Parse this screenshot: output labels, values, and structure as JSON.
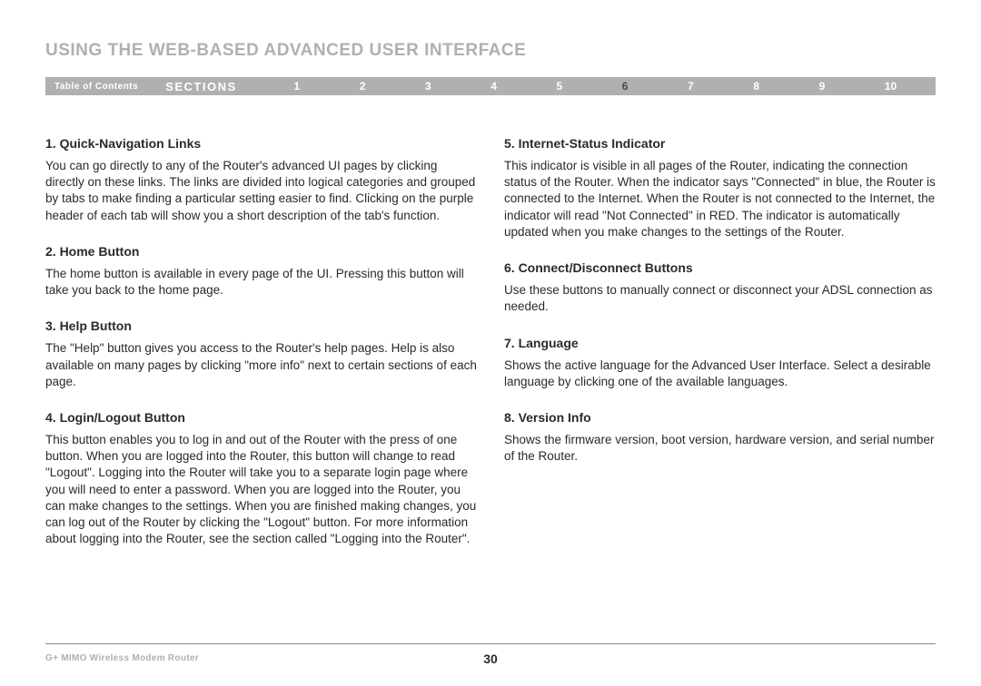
{
  "title": "USING THE WEB-BASED ADVANCED USER INTERFACE",
  "nav": {
    "toc": "Table of Contents",
    "sections_label": "SECTIONS",
    "numbers": [
      "1",
      "2",
      "3",
      "4",
      "5",
      "6",
      "7",
      "8",
      "9",
      "10"
    ],
    "active": "6"
  },
  "left": [
    {
      "heading": "1. Quick-Navigation Links",
      "body": "You can go directly to any of the Router's advanced UI pages by clicking directly on these links. The links are divided into logical categories and grouped by tabs to make finding a particular setting easier to find. Clicking on the purple header of each tab will show you a short description of the tab's function."
    },
    {
      "heading": "2. Home Button",
      "body": "The home button is available in every page of the UI. Pressing this button will take you back to the home page."
    },
    {
      "heading": "3. Help Button",
      "body": "The \"Help\" button gives you access to the Router's help pages. Help is also available on many pages by clicking \"more info\" next to certain sections of each page."
    },
    {
      "heading": "4. Login/Logout Button",
      "body": "This button enables you to log in and out of the Router with the press of one button. When you are logged into the Router, this button will change to read \"Logout\". Logging into the Router will take you to a separate login page where you will need to enter a password. When you are logged into the Router, you can make changes to the settings. When you are finished making changes, you can log out of the Router by clicking the \"Logout\" button. For more information about logging into the Router, see the section called \"Logging into the Router\"."
    }
  ],
  "right": [
    {
      "heading": "5. Internet-Status Indicator",
      "body": "This indicator is visible in all pages of the Router, indicating the connection status of the Router. When the indicator says \"Connected\" in blue, the Router is connected to the Internet. When the Router is not connected to the Internet, the indicator will read \"Not Connected\" in RED. The indicator is automatically updated when you make changes to the settings of the Router."
    },
    {
      "heading": "6. Connect/Disconnect Buttons",
      "body": "Use these buttons to manually connect or disconnect your ADSL connection as needed."
    },
    {
      "heading": "7. Language",
      "body": "Shows the active language for the Advanced User Interface. Select a desirable language by clicking one of the available languages."
    },
    {
      "heading": "8. Version Info",
      "body": "Shows the firmware version, boot version, hardware version, and serial number of the Router."
    }
  ],
  "footer": {
    "product": "G+ MIMO Wireless Modem Router",
    "page": "30"
  }
}
